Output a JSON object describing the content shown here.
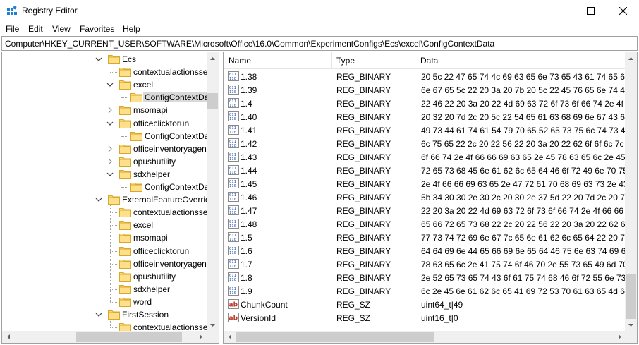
{
  "window": {
    "title": "Registry Editor",
    "accent_color": "#0078d7"
  },
  "menu": [
    {
      "label": "File"
    },
    {
      "label": "Edit"
    },
    {
      "label": "View"
    },
    {
      "label": "Favorites"
    },
    {
      "label": "Help"
    }
  ],
  "address": {
    "path": "Computer\\HKEY_CURRENT_USER\\SOFTWARE\\Microsoft\\Office\\16.0\\Common\\ExperimentConfigs\\Ecs\\excel\\ConfigContextData"
  },
  "tree": {
    "nodes": [
      {
        "label": "Ecs",
        "expanded": true,
        "has_children": true
      },
      {
        "label": "contextualactionsse",
        "has_children": false
      },
      {
        "label": "excel",
        "expanded": true,
        "has_children": true
      },
      {
        "label": "ConfigContextDa",
        "selected": true,
        "has_children": false
      },
      {
        "label": "msomapi",
        "expanded": false,
        "has_children": true
      },
      {
        "label": "officeclicktorun",
        "expanded": true,
        "has_children": true
      },
      {
        "label": "ConfigContextDa",
        "has_children": false
      },
      {
        "label": "officeinventoryagen",
        "expanded": false,
        "has_children": true
      },
      {
        "label": "opushutility",
        "expanded": false,
        "has_children": true
      },
      {
        "label": "sdxhelper",
        "expanded": true,
        "has_children": true
      },
      {
        "label": "ConfigContextDa",
        "has_children": false
      },
      {
        "label": "ExternalFeatureOverrid",
        "expanded": true,
        "has_children": true
      },
      {
        "label": "contextualactionsse",
        "has_children": false
      },
      {
        "label": "excel",
        "has_children": false
      },
      {
        "label": "msomapi",
        "has_children": false
      },
      {
        "label": "officeclicktorun",
        "has_children": false
      },
      {
        "label": "officeinventoryagen",
        "has_children": false
      },
      {
        "label": "opushutility",
        "has_children": false
      },
      {
        "label": "sdxhelper",
        "has_children": false
      },
      {
        "label": "word",
        "has_children": false
      },
      {
        "label": "FirstSession",
        "expanded": true,
        "has_children": true
      },
      {
        "label": "contextualactionsse",
        "has_children": false
      }
    ]
  },
  "list": {
    "columns": [
      {
        "label": "Name"
      },
      {
        "label": "Type"
      },
      {
        "label": "Data"
      }
    ],
    "rows": [
      {
        "icon": "binary-value-icon",
        "name": "1.38",
        "type": "REG_BINARY",
        "data": "20 5c 22 47 65 74 4c 69 63 65 6e 73 65 43 61 74 65 67 6f 72"
      },
      {
        "icon": "binary-value-icon",
        "name": "1.39",
        "type": "REG_BINARY",
        "data": "6e 67 65 5c 22 20 3a 20 7b 20 5c 22 45 76 65 6e 74 46 6c 61"
      },
      {
        "icon": "binary-value-icon",
        "name": "1.4",
        "type": "REG_BINARY",
        "data": "22 46 22 20 3a 20 22 4d 69 63 72 6f 73 6f 66 74 2e 4f 66 66"
      },
      {
        "icon": "binary-value-icon",
        "name": "1.40",
        "type": "REG_BINARY",
        "data": "20 32 20 7d 2c 20 5c 22 54 65 61 63 68 69 6e 67 43 61 6c 6c"
      },
      {
        "icon": "binary-value-icon",
        "name": "1.41",
        "type": "REG_BINARY",
        "data": "49 73 44 61 74 61 54 79 70 65 52 65 73 75 6c 74 73 45 6e 61"
      },
      {
        "icon": "binary-value-icon",
        "name": "1.42",
        "type": "REG_BINARY",
        "data": "6c 75 65 22 2c 20 22 56 22 20 3a 20 22 62 6f 6f 6c 7c 31 22"
      },
      {
        "icon": "binary-value-icon",
        "name": "1.43",
        "type": "REG_BINARY",
        "data": "6f 66 74 2e 4f 66 66 69 63 65 2e 45 78 63 65 6c 2e 45 6e 61"
      },
      {
        "icon": "binary-value-icon",
        "name": "1.44",
        "type": "REG_BINARY",
        "data": "72 65 73 68 45 6e 61 62 6c 65 64 46 6f 72 49 6e 70 75 74 20"
      },
      {
        "icon": "binary-value-icon",
        "name": "1.45",
        "type": "REG_BINARY",
        "data": "2e 4f 66 66 69 63 65 2e 47 72 61 70 68 69 63 73 2e 43 47 43"
      },
      {
        "icon": "binary-value-icon",
        "name": "1.46",
        "type": "REG_BINARY",
        "data": "5b 34 30 30 2e 30 2c 20 30 2e 37 5d 22 20 7d 2c 20 7b 20 22"
      },
      {
        "icon": "binary-value-icon",
        "name": "1.47",
        "type": "REG_BINARY",
        "data": "22 20 3a 20 22 4d 69 63 72 6f 73 6f 66 74 2e 4f 66 66 69 63"
      },
      {
        "icon": "binary-value-icon",
        "name": "1.48",
        "type": "REG_BINARY",
        "data": "65 66 72 65 73 68 22 2c 20 22 56 22 20 3a 20 22 62 6f 6f 6c"
      },
      {
        "icon": "binary-value-icon",
        "name": "1.5",
        "type": "REG_BINARY",
        "data": "77 73 74 72 69 6e 67 7c 65 6e 61 62 6c 65 64 22 20 7d 2c 20"
      },
      {
        "icon": "binary-value-icon",
        "name": "1.6",
        "type": "REG_BINARY",
        "data": "64 64 69 6e 44 65 66 69 6e 65 64 46 75 6e 63 74 69 6f 6e 47"
      },
      {
        "icon": "binary-value-icon",
        "name": "1.7",
        "type": "REG_BINARY",
        "data": "78 63 65 6c 2e 41 75 74 6f 46 70 2e 55 73 65 49 6d 70 72 6f"
      },
      {
        "icon": "binary-value-icon",
        "name": "1.8",
        "type": "REG_BINARY",
        "data": "2e 52 65 73 65 74 43 6f 61 75 74 68 46 6f 72 55 6e 73 75 70"
      },
      {
        "icon": "binary-value-icon",
        "name": "1.9",
        "type": "REG_BINARY",
        "data": "6c 2e 45 6e 61 62 6c 65 41 69 72 53 70 61 63 65 4d 65 6e 75"
      },
      {
        "icon": "string-value-icon",
        "name": "ChunkCount",
        "type": "REG_SZ",
        "data": "uint64_t|49"
      },
      {
        "icon": "string-value-icon",
        "name": "VersionId",
        "type": "REG_SZ",
        "data": "uint16_t|0"
      }
    ]
  }
}
